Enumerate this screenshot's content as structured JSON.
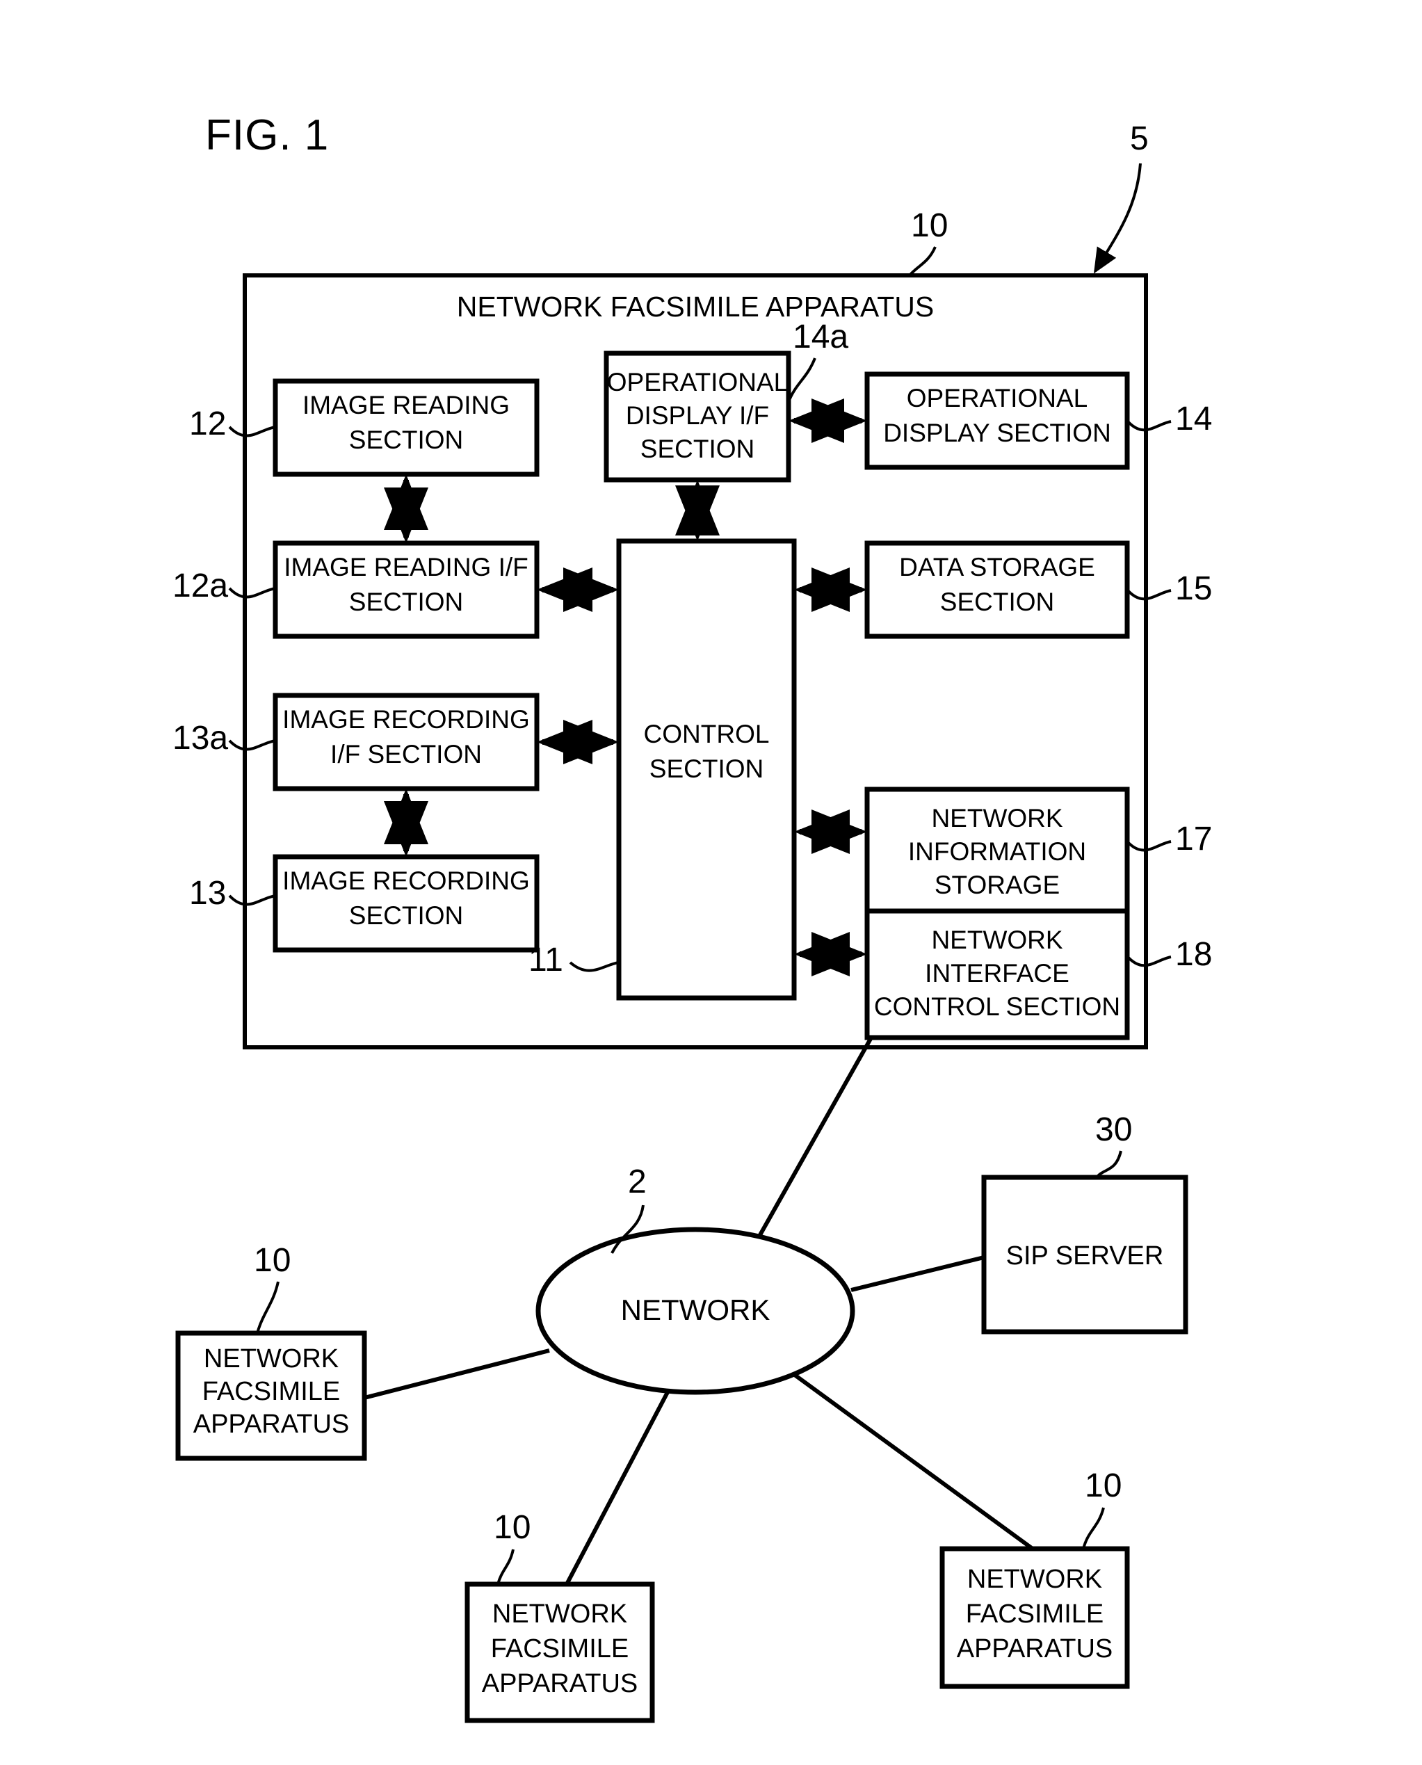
{
  "figure": {
    "title": "FIG. 1",
    "system_ref": "5"
  },
  "apparatus": {
    "title": "NETWORK FACSIMILE APPARATUS",
    "ref": "10",
    "blocks": [
      {
        "id": "image-reading-section",
        "label_lines": [
          "IMAGE READING",
          "SECTION"
        ],
        "ref": "12"
      },
      {
        "id": "image-reading-if-section",
        "label_lines": [
          "IMAGE READING I/F",
          "SECTION"
        ],
        "ref": "12a"
      },
      {
        "id": "image-recording-if-section",
        "label_lines": [
          "IMAGE RECORDING",
          "I/F SECTION"
        ],
        "ref": "13a"
      },
      {
        "id": "image-recording-section",
        "label_lines": [
          "IMAGE RECORDING",
          "SECTION"
        ],
        "ref": "13"
      },
      {
        "id": "operational-display-if-section",
        "label_lines": [
          "OPERATIONAL",
          "DISPLAY I/F",
          "SECTION"
        ],
        "ref": "14a"
      },
      {
        "id": "operational-display-section",
        "label_lines": [
          "OPERATIONAL",
          "DISPLAY SECTION"
        ],
        "ref": "14"
      },
      {
        "id": "control-section",
        "label_lines": [
          "CONTROL",
          "SECTION"
        ],
        "ref": "11"
      },
      {
        "id": "data-storage-section",
        "label_lines": [
          "DATA STORAGE",
          "SECTION"
        ],
        "ref": "15"
      },
      {
        "id": "network-information-storage",
        "label_lines": [
          "NETWORK",
          "INFORMATION",
          "STORAGE"
        ],
        "ref": "17"
      },
      {
        "id": "network-interface-control-section",
        "label_lines": [
          "NETWORK",
          "INTERFACE",
          "CONTROL SECTION"
        ],
        "ref": "18"
      }
    ]
  },
  "network": {
    "label": "NETWORK",
    "ref": "2"
  },
  "sip_server": {
    "label": "SIP SERVER",
    "ref": "30"
  },
  "peers": [
    {
      "id": "peer-left",
      "label_lines": [
        "NETWORK",
        "FACSIMILE",
        "APPARATUS"
      ],
      "ref": "10"
    },
    {
      "id": "peer-bottom-center",
      "label_lines": [
        "NETWORK",
        "FACSIMILE",
        "APPARATUS"
      ],
      "ref": "10"
    },
    {
      "id": "peer-bottom-right",
      "label_lines": [
        "NETWORK",
        "FACSIMILE",
        "APPARATUS"
      ],
      "ref": "10"
    }
  ],
  "colors": {
    "ink": "#000000",
    "paper": "#ffffff"
  }
}
